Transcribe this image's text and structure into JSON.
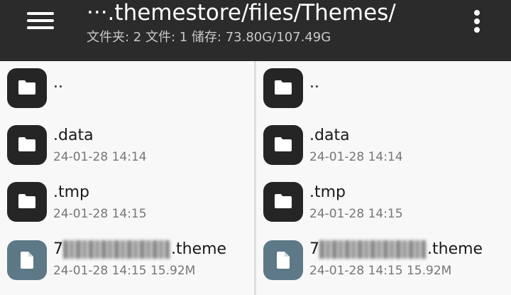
{
  "appbar": {
    "title": "···.themestore/files/Themes/",
    "subtitle": "文件夹: 2  文件: 1  储存: 73.80G/107.49G",
    "menu_icon": "hamburger-menu-icon",
    "more_icon": "more-vertical-icon"
  },
  "colors": {
    "appbar_bg": "#2b2b2b",
    "folder_icon_bg": "#252525",
    "file_icon_bg": "#5d7886",
    "pane_bg": "#f8f8f8"
  },
  "panes": [
    {
      "items": [
        {
          "type": "folder",
          "name": "..",
          "meta": ""
        },
        {
          "type": "folder",
          "name": ".data",
          "meta": "24-01-28 14:14"
        },
        {
          "type": "folder",
          "name": ".tmp",
          "meta": "24-01-28 14:15"
        },
        {
          "type": "file",
          "name_prefix": "7",
          "name": ".theme",
          "meta": "24-01-28 14:15  15.92M"
        }
      ]
    },
    {
      "items": [
        {
          "type": "folder",
          "name": "..",
          "meta": ""
        },
        {
          "type": "folder",
          "name": ".data",
          "meta": "24-01-28 14:14"
        },
        {
          "type": "folder",
          "name": ".tmp",
          "meta": "24-01-28 14:15"
        },
        {
          "type": "file",
          "name_prefix": "7",
          "name": ".theme",
          "meta": "24-01-28 14:15  15.92M"
        }
      ]
    }
  ]
}
